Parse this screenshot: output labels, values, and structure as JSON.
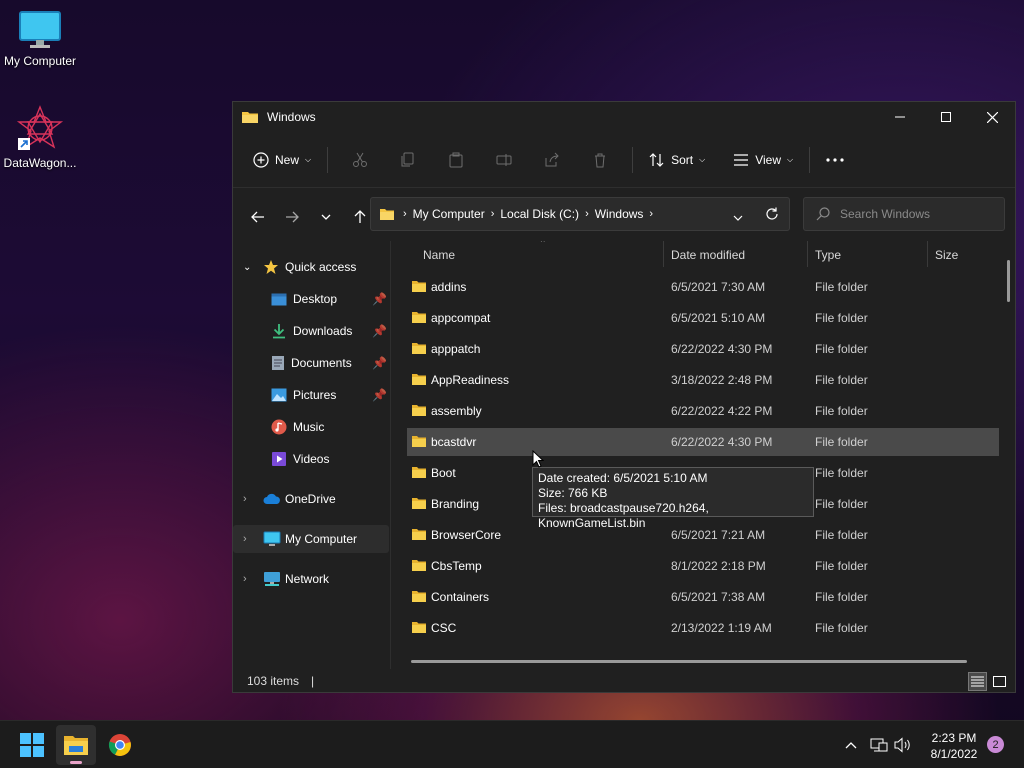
{
  "desktop": {
    "icons": [
      {
        "label": "My Computer",
        "icon": "monitor-icon"
      },
      {
        "label": "DataWagon...",
        "icon": "shortcut-icon"
      }
    ]
  },
  "window": {
    "title": "Windows",
    "toolbar": {
      "new_label": "New",
      "sort_label": "Sort",
      "view_label": "View",
      "disabled_icons": [
        "cut-icon",
        "copy-icon",
        "paste-icon",
        "rename-icon",
        "share-icon",
        "delete-icon"
      ]
    },
    "address": {
      "crumbs": [
        "My Computer",
        "Local Disk (C:)",
        "Windows"
      ]
    },
    "search": {
      "placeholder": "Search Windows"
    },
    "nav": {
      "quick_access": "Quick access",
      "items": [
        {
          "label": "Desktop",
          "pinned": true
        },
        {
          "label": "Downloads",
          "pinned": true
        },
        {
          "label": "Documents",
          "pinned": true
        },
        {
          "label": "Pictures",
          "pinned": true
        },
        {
          "label": "Music",
          "pinned": false
        },
        {
          "label": "Videos",
          "pinned": false
        }
      ],
      "onedrive": "OneDrive",
      "my_computer": "My Computer",
      "network": "Network"
    },
    "columns": {
      "name": "Name",
      "date": "Date modified",
      "type": "Type",
      "size": "Size"
    },
    "files": [
      {
        "name": "addins",
        "date": "6/5/2021 7:30 AM",
        "type": "File folder"
      },
      {
        "name": "appcompat",
        "date": "6/5/2021 5:10 AM",
        "type": "File folder"
      },
      {
        "name": "apppatch",
        "date": "6/22/2022 4:30 PM",
        "type": "File folder"
      },
      {
        "name": "AppReadiness",
        "date": "3/18/2022 2:48 PM",
        "type": "File folder"
      },
      {
        "name": "assembly",
        "date": "6/22/2022 4:22 PM",
        "type": "File folder"
      },
      {
        "name": "bcastdvr",
        "date": "6/22/2022 4:30 PM",
        "type": "File folder"
      },
      {
        "name": "Boot",
        "date": "",
        "type": "File folder"
      },
      {
        "name": "Branding",
        "date": "",
        "type": "File folder"
      },
      {
        "name": "BrowserCore",
        "date": "6/5/2021 7:21 AM",
        "type": "File folder"
      },
      {
        "name": "CbsTemp",
        "date": "8/1/2022 2:18 PM",
        "type": "File folder"
      },
      {
        "name": "Containers",
        "date": "6/5/2021 7:38 AM",
        "type": "File folder"
      },
      {
        "name": "CSC",
        "date": "2/13/2022 1:19 AM",
        "type": "File folder"
      }
    ],
    "tooltip": {
      "line1": "Date created: 6/5/2021 5:10 AM",
      "line2": "Size: 766 KB",
      "line3": "Files: broadcastpause720.h264, KnownGameList.bin"
    },
    "status": {
      "items": "103 items",
      "cursor": "|"
    }
  },
  "taskbar": {
    "time": "2:23 PM",
    "date": "8/1/2022",
    "notifications": "2"
  },
  "colors": {
    "accent": "#0078d4",
    "folder": "#f4c542",
    "hover_row": "#4a4a4a"
  }
}
